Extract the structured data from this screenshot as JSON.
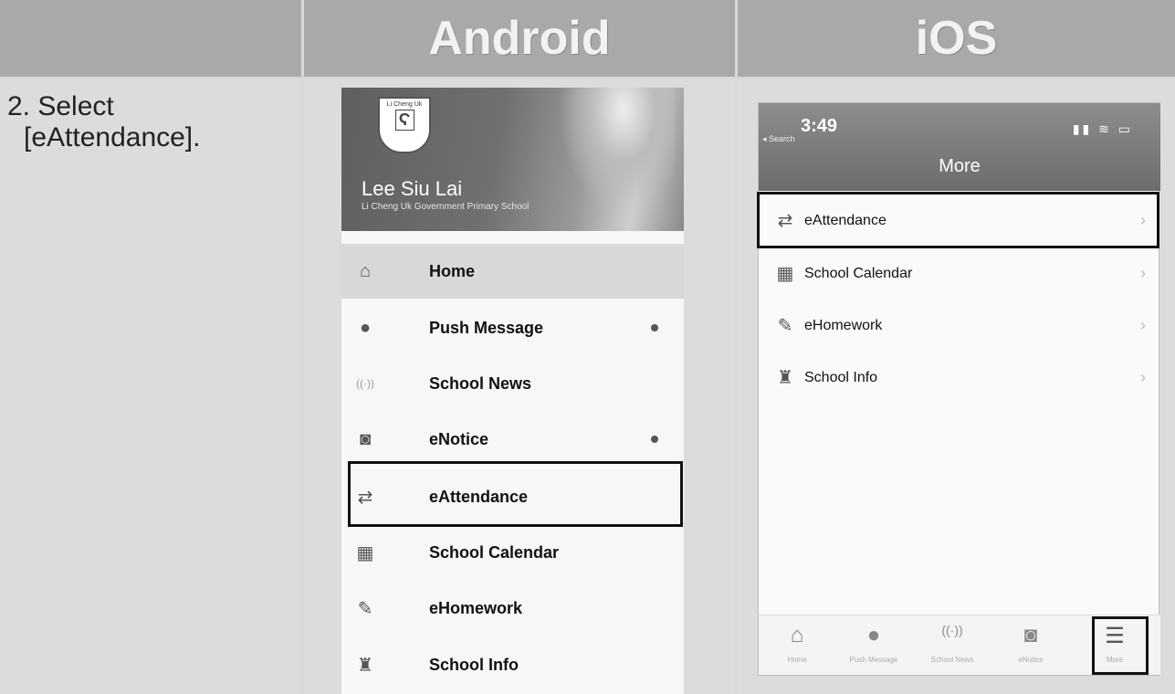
{
  "header": {
    "col1": "",
    "col2": "Android",
    "col3": "iOS"
  },
  "instruction": {
    "line1": "2. Select",
    "line2": "[eAttendance]."
  },
  "android": {
    "logo_text": "Li Cheng Uk",
    "user_name": "Lee Siu Lai",
    "school_name": "Li Cheng Uk Government Primary School",
    "menu": [
      {
        "label": "Home",
        "icon": "home-icon",
        "active": true,
        "dot": false
      },
      {
        "label": "Push Message",
        "icon": "message-icon",
        "active": false,
        "dot": true
      },
      {
        "label": "School News",
        "icon": "broadcast-icon",
        "active": false,
        "dot": false
      },
      {
        "label": "eNotice",
        "icon": "notice-icon",
        "active": false,
        "dot": true
      },
      {
        "label": "eAttendance",
        "icon": "attendance-arrows-icon",
        "active": false,
        "dot": false,
        "highlighted": true
      },
      {
        "label": "School Calendar",
        "icon": "calendar-icon",
        "active": false,
        "dot": false
      },
      {
        "label": "eHomework",
        "icon": "homework-icon",
        "active": false,
        "dot": false
      },
      {
        "label": "School Info",
        "icon": "school-info-icon",
        "active": false,
        "dot": false
      }
    ]
  },
  "ios": {
    "time": "3:49",
    "back_label": "◂ Search",
    "title": "More",
    "rows": [
      {
        "label": "eAttendance",
        "icon": "attendance-arrows-icon",
        "highlighted": true
      },
      {
        "label": "School Calendar",
        "icon": "calendar-icon"
      },
      {
        "label": "eHomework",
        "icon": "homework-icon"
      },
      {
        "label": "School Info",
        "icon": "school-info-icon"
      }
    ],
    "tabs": [
      {
        "label": "Home",
        "icon": "home-icon"
      },
      {
        "label": "Push Message",
        "icon": "message-icon"
      },
      {
        "label": "School News",
        "icon": "broadcast-icon"
      },
      {
        "label": "eNotice",
        "icon": "notice-icon"
      },
      {
        "label": "More",
        "icon": "menu-icon",
        "highlighted": true
      }
    ]
  }
}
